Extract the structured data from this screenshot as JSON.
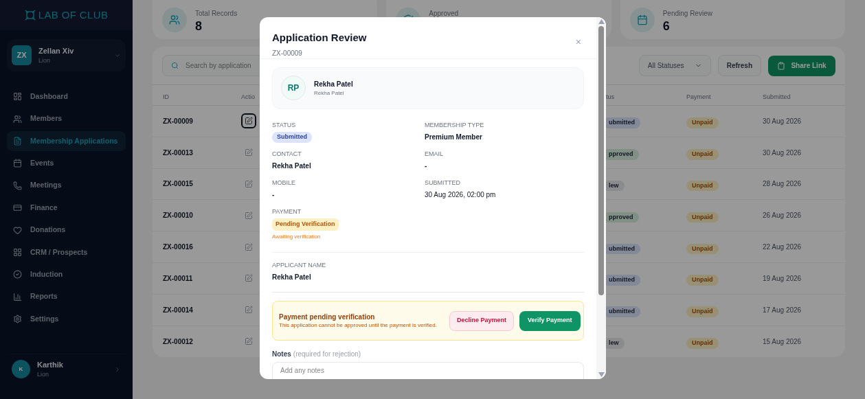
{
  "sidebar": {
    "logo": "LAB OF CLUB",
    "account": {
      "initials": "ZX",
      "name": "Zellan Xiv",
      "role": "Lion"
    },
    "nav": [
      {
        "label": "Dashboard",
        "selected": false
      },
      {
        "label": "Members",
        "selected": false
      },
      {
        "label": "Membership Applications",
        "selected": true
      },
      {
        "label": "Events",
        "selected": false
      },
      {
        "label": "Meetings",
        "selected": false
      },
      {
        "label": "Finance",
        "selected": false
      },
      {
        "label": "Donations",
        "selected": false
      },
      {
        "label": "CRM / Prospects",
        "selected": false
      },
      {
        "label": "Induction",
        "selected": false
      },
      {
        "label": "Reports",
        "selected": false
      },
      {
        "label": "Settings",
        "selected": false
      }
    ],
    "user": {
      "initial": "K",
      "name": "Karthik",
      "role": "Lion"
    }
  },
  "stats": [
    {
      "label": "Total Records",
      "value": "8"
    },
    {
      "label": "Approved"
    },
    {
      "label": "Pending Review",
      "value": "6"
    }
  ],
  "toolbar": {
    "search_placeholder": "Search by application",
    "filter": "All Statuses",
    "refresh": "Refresh",
    "share": "Share Link"
  },
  "table": {
    "columns": [
      "ID",
      "Actio",
      "tus",
      "Payment",
      "Submitted"
    ],
    "rows": [
      {
        "id": "ZX-00009",
        "focused": true,
        "status": "ubmitted",
        "color": "#838997",
        "payment": "Unpaid",
        "submitted": "30 Aug 2026"
      },
      {
        "id": "ZX-00013",
        "focused": false,
        "status": "pproved",
        "color": "#809086",
        "payment": "Unpaid",
        "submitted": "30 Aug 2026"
      },
      {
        "id": "ZX-00015",
        "focused": false,
        "status": "lew",
        "color": "#898b8d",
        "payment": "Unpaid",
        "submitted": "28 Aug 2026"
      },
      {
        "id": "ZX-00010",
        "focused": false,
        "status": "pproved",
        "color": "#809086",
        "payment": "Unpaid",
        "submitted": "26 Aug 2026"
      },
      {
        "id": "ZX-00016",
        "focused": false,
        "status": "ubmitted",
        "color": "#838997",
        "payment": "Unpaid",
        "submitted": "22 Aug 2026"
      },
      {
        "id": "ZX-00011",
        "focused": false,
        "status": "ubmitted",
        "color": "#838997",
        "payment": "Unpaid",
        "submitted": "19 Aug 2026"
      },
      {
        "id": "ZX-00014",
        "focused": false,
        "status": "ubmitted",
        "color": "#838997",
        "payment": "Unpaid",
        "submitted": "17 Aug 2026"
      },
      {
        "id": "ZX-00012",
        "focused": false,
        "status": "lew",
        "color": "#898b8d",
        "payment": "Unpaid",
        "submitted": "15 Aug 2026"
      }
    ]
  },
  "modal": {
    "title": "Application Review",
    "subtitle": "ZX-00009",
    "close": "×",
    "applicant": {
      "initials": "RP",
      "name": "Rekha Patel",
      "subname": "Rekha Patel"
    },
    "fields": [
      {
        "label": "STATUS",
        "value": "Submitted",
        "kind": "badge"
      },
      {
        "label": "MEMBERSHIP TYPE",
        "value": "Premium Member",
        "kind": "text"
      },
      {
        "label": "CONTACT",
        "value": "Rekha Patel",
        "kind": "text"
      },
      {
        "label": "EMAIL",
        "value": "-",
        "kind": "text"
      },
      {
        "label": "MOBILE",
        "value": "-",
        "kind": "text"
      },
      {
        "label": "SUBMITTED",
        "value": "30 Aug 2026, 02:00 pm",
        "kind": "plain"
      }
    ],
    "payment": {
      "label": "PAYMENT",
      "badge": "Pending Verification",
      "note": "Awaiting verification"
    },
    "applicant_name": {
      "label": "APPLICANT NAME",
      "value": "Rekha Patel"
    },
    "alert": {
      "title": "Payment pending verification",
      "text": "This application cannot be approved until the payment is verified.",
      "decline": "Decline Payment",
      "verify": "Verify Payment"
    },
    "notes": {
      "label": "Notes",
      "hint": "(required for rejection)",
      "placeholder": "Add any notes"
    }
  }
}
